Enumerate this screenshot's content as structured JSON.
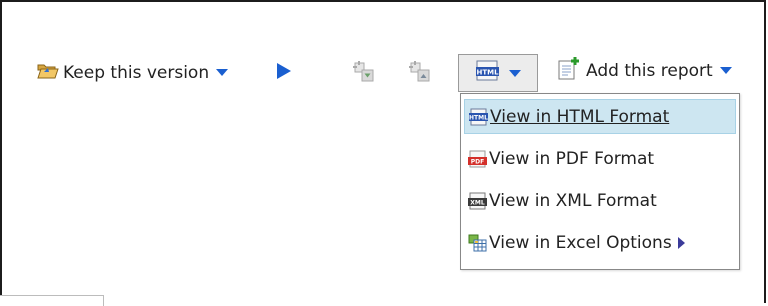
{
  "toolbar": {
    "keep_version_label": "Keep this version",
    "add_report_label": "Add this report",
    "view_format_icon_text": "HTML"
  },
  "format_menu": {
    "items": [
      {
        "label": "View in HTML Format",
        "icon": "html-format-icon",
        "icon_text": "HTML",
        "selected": true
      },
      {
        "label": "View in PDF Format",
        "icon": "pdf-format-icon",
        "icon_text": "PDF"
      },
      {
        "label": "View in XML Format",
        "icon": "xml-format-icon",
        "icon_text": "XML"
      },
      {
        "label": "View in Excel Options",
        "icon": "excel-format-icon",
        "has_submenu": true
      }
    ]
  },
  "colors": {
    "accent_blue": "#1a5fd0",
    "selected_bg": "#cde6f1",
    "pdf_red": "#d4302b"
  }
}
